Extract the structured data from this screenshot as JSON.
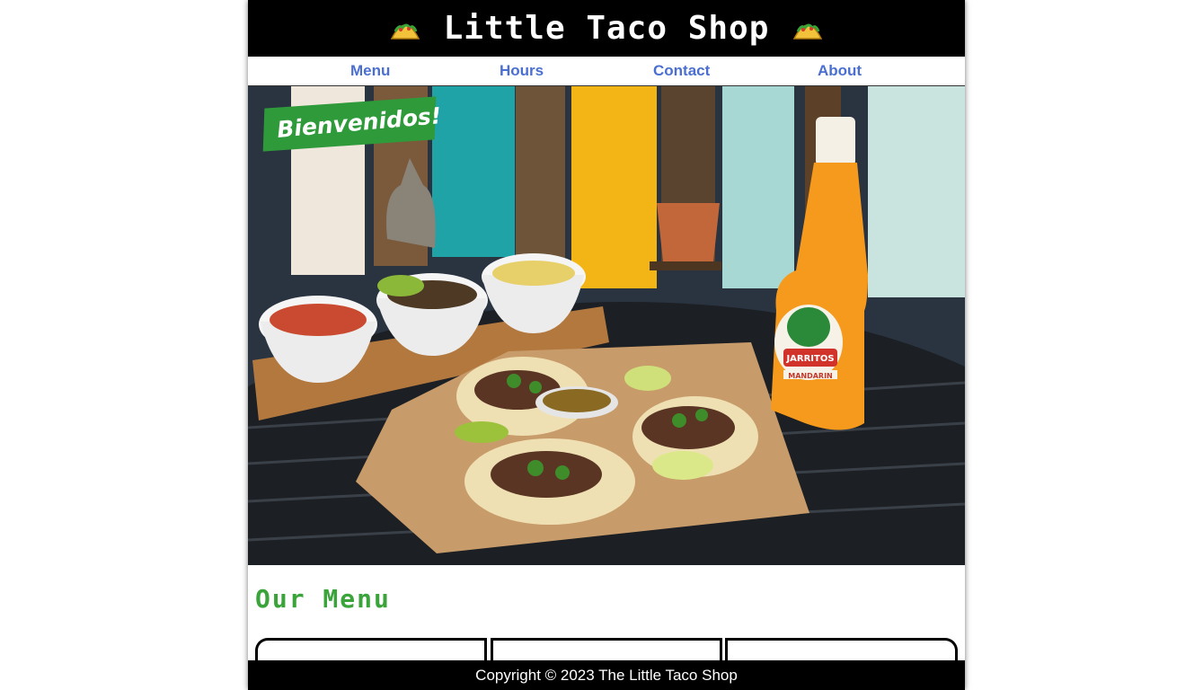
{
  "header": {
    "title": "Little Taco Shop",
    "left_icon": "taco-icon",
    "right_icon": "taco-icon"
  },
  "nav": {
    "items": [
      {
        "label": "Menu"
      },
      {
        "label": "Hours"
      },
      {
        "label": "Contact"
      },
      {
        "label": "About"
      }
    ]
  },
  "hero": {
    "banner": "Bienvenidos!",
    "image_subject": "tacos with salsa bowls and a Jarritos bottle on a table"
  },
  "main": {
    "section_title": "Our Menu",
    "cards_count": 3
  },
  "footer": {
    "copyright": "Copyright © 2023 The Little Taco Shop"
  },
  "colors": {
    "header_bg": "#000000",
    "nav_link": "#4a6fd0",
    "accent_green": "#3aa43a",
    "banner_green": "#2e9a3a"
  }
}
